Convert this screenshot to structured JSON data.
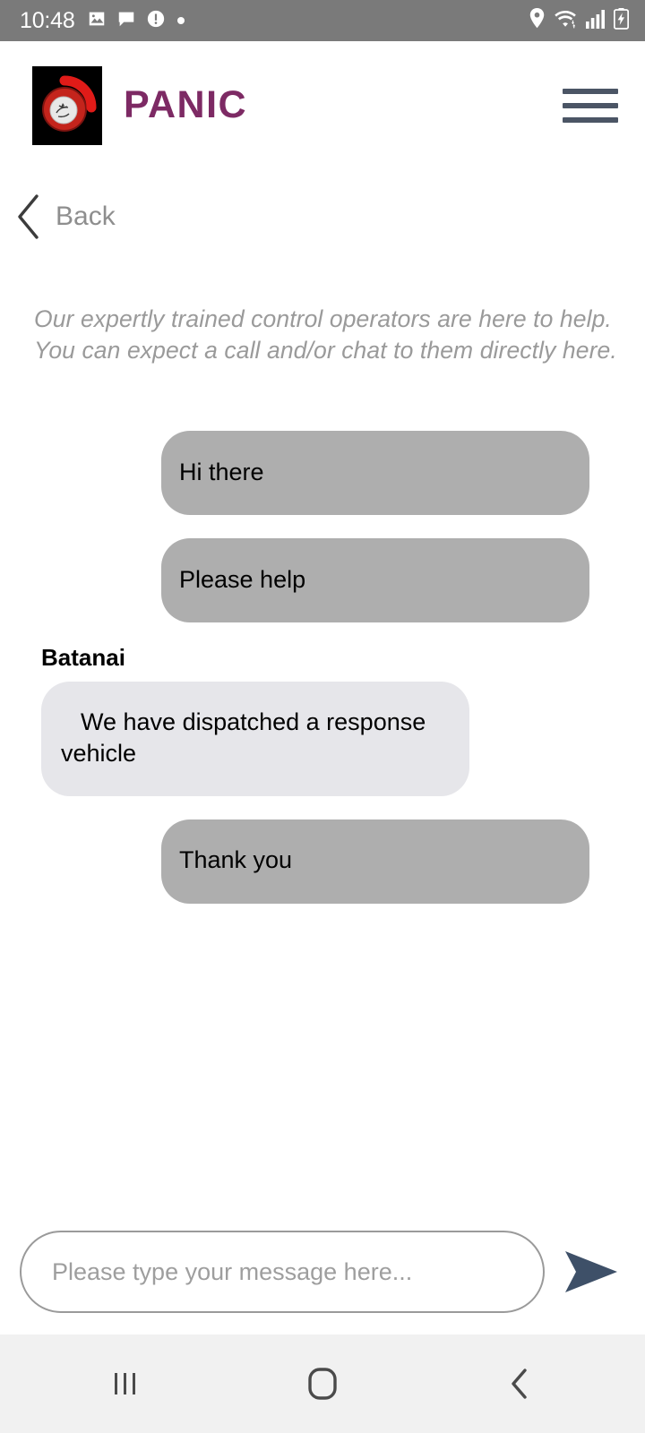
{
  "status_bar": {
    "time": "10:48",
    "left_icons": [
      "image-icon",
      "message-icon",
      "alert-circle-icon",
      "dot-icon"
    ],
    "right_icons": [
      "location-pin-icon",
      "wifi-icon",
      "signal-bars-icon",
      "battery-charging-icon"
    ],
    "background_color": "#7a7a7a",
    "icon_color": "#ffffff"
  },
  "header": {
    "logo_alt": "panic-logo",
    "brand": "PANIC",
    "brand_color": "#7d2a64",
    "menu_label": "menu",
    "menu_color": "#4b5565"
  },
  "nav": {
    "back_label": "Back",
    "back_color": "#8e8e8e"
  },
  "intro": {
    "line1": "Our expertly trained control operators are here to help.",
    "line2": "You can expect a call and/or chat to them directly here.",
    "color": "#9a9a9a"
  },
  "chat": {
    "outgoing_bubble_color": "#aeaeae",
    "incoming_bubble_color": "#e6e6ea",
    "messages": [
      {
        "direction": "outgoing",
        "sender": "",
        "text": "Hi there"
      },
      {
        "direction": "outgoing",
        "sender": "",
        "text": "Please help"
      },
      {
        "direction": "incoming",
        "sender": "Batanai",
        "text": "We have dispatched a response vehicle"
      },
      {
        "direction": "outgoing",
        "sender": "",
        "text": "Thank you"
      }
    ]
  },
  "composer": {
    "placeholder": "Please type your message here...",
    "value": "",
    "send_label": "Send",
    "send_color": "#3e5068"
  },
  "system_nav": {
    "recents_label": "Recents",
    "home_label": "Home",
    "back_label": "Back",
    "background_color": "#f1f1f1",
    "icon_color": "#4a4a4a"
  }
}
